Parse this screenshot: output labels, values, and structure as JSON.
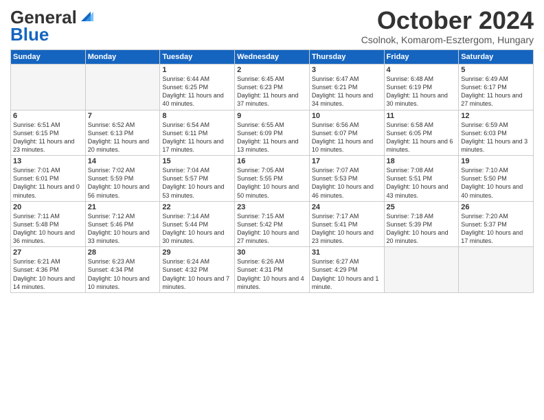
{
  "header": {
    "logo_top": "General",
    "logo_bottom": "Blue",
    "month_title": "October 2024",
    "subtitle": "Csolnok, Komarom-Esztergom, Hungary"
  },
  "days_of_week": [
    "Sunday",
    "Monday",
    "Tuesday",
    "Wednesday",
    "Thursday",
    "Friday",
    "Saturday"
  ],
  "weeks": [
    [
      {
        "day": "",
        "empty": true
      },
      {
        "day": "",
        "empty": true
      },
      {
        "day": "1",
        "sunrise": "Sunrise: 6:44 AM",
        "sunset": "Sunset: 6:25 PM",
        "daylight": "Daylight: 11 hours and 40 minutes."
      },
      {
        "day": "2",
        "sunrise": "Sunrise: 6:45 AM",
        "sunset": "Sunset: 6:23 PM",
        "daylight": "Daylight: 11 hours and 37 minutes."
      },
      {
        "day": "3",
        "sunrise": "Sunrise: 6:47 AM",
        "sunset": "Sunset: 6:21 PM",
        "daylight": "Daylight: 11 hours and 34 minutes."
      },
      {
        "day": "4",
        "sunrise": "Sunrise: 6:48 AM",
        "sunset": "Sunset: 6:19 PM",
        "daylight": "Daylight: 11 hours and 30 minutes."
      },
      {
        "day": "5",
        "sunrise": "Sunrise: 6:49 AM",
        "sunset": "Sunset: 6:17 PM",
        "daylight": "Daylight: 11 hours and 27 minutes."
      }
    ],
    [
      {
        "day": "6",
        "sunrise": "Sunrise: 6:51 AM",
        "sunset": "Sunset: 6:15 PM",
        "daylight": "Daylight: 11 hours and 23 minutes."
      },
      {
        "day": "7",
        "sunrise": "Sunrise: 6:52 AM",
        "sunset": "Sunset: 6:13 PM",
        "daylight": "Daylight: 11 hours and 20 minutes."
      },
      {
        "day": "8",
        "sunrise": "Sunrise: 6:54 AM",
        "sunset": "Sunset: 6:11 PM",
        "daylight": "Daylight: 11 hours and 17 minutes."
      },
      {
        "day": "9",
        "sunrise": "Sunrise: 6:55 AM",
        "sunset": "Sunset: 6:09 PM",
        "daylight": "Daylight: 11 hours and 13 minutes."
      },
      {
        "day": "10",
        "sunrise": "Sunrise: 6:56 AM",
        "sunset": "Sunset: 6:07 PM",
        "daylight": "Daylight: 11 hours and 10 minutes."
      },
      {
        "day": "11",
        "sunrise": "Sunrise: 6:58 AM",
        "sunset": "Sunset: 6:05 PM",
        "daylight": "Daylight: 11 hours and 6 minutes."
      },
      {
        "day": "12",
        "sunrise": "Sunrise: 6:59 AM",
        "sunset": "Sunset: 6:03 PM",
        "daylight": "Daylight: 11 hours and 3 minutes."
      }
    ],
    [
      {
        "day": "13",
        "sunrise": "Sunrise: 7:01 AM",
        "sunset": "Sunset: 6:01 PM",
        "daylight": "Daylight: 11 hours and 0 minutes."
      },
      {
        "day": "14",
        "sunrise": "Sunrise: 7:02 AM",
        "sunset": "Sunset: 5:59 PM",
        "daylight": "Daylight: 10 hours and 56 minutes."
      },
      {
        "day": "15",
        "sunrise": "Sunrise: 7:04 AM",
        "sunset": "Sunset: 5:57 PM",
        "daylight": "Daylight: 10 hours and 53 minutes."
      },
      {
        "day": "16",
        "sunrise": "Sunrise: 7:05 AM",
        "sunset": "Sunset: 5:55 PM",
        "daylight": "Daylight: 10 hours and 50 minutes."
      },
      {
        "day": "17",
        "sunrise": "Sunrise: 7:07 AM",
        "sunset": "Sunset: 5:53 PM",
        "daylight": "Daylight: 10 hours and 46 minutes."
      },
      {
        "day": "18",
        "sunrise": "Sunrise: 7:08 AM",
        "sunset": "Sunset: 5:51 PM",
        "daylight": "Daylight: 10 hours and 43 minutes."
      },
      {
        "day": "19",
        "sunrise": "Sunrise: 7:10 AM",
        "sunset": "Sunset: 5:50 PM",
        "daylight": "Daylight: 10 hours and 40 minutes."
      }
    ],
    [
      {
        "day": "20",
        "sunrise": "Sunrise: 7:11 AM",
        "sunset": "Sunset: 5:48 PM",
        "daylight": "Daylight: 10 hours and 36 minutes."
      },
      {
        "day": "21",
        "sunrise": "Sunrise: 7:12 AM",
        "sunset": "Sunset: 5:46 PM",
        "daylight": "Daylight: 10 hours and 33 minutes."
      },
      {
        "day": "22",
        "sunrise": "Sunrise: 7:14 AM",
        "sunset": "Sunset: 5:44 PM",
        "daylight": "Daylight: 10 hours and 30 minutes."
      },
      {
        "day": "23",
        "sunrise": "Sunrise: 7:15 AM",
        "sunset": "Sunset: 5:42 PM",
        "daylight": "Daylight: 10 hours and 27 minutes."
      },
      {
        "day": "24",
        "sunrise": "Sunrise: 7:17 AM",
        "sunset": "Sunset: 5:41 PM",
        "daylight": "Daylight: 10 hours and 23 minutes."
      },
      {
        "day": "25",
        "sunrise": "Sunrise: 7:18 AM",
        "sunset": "Sunset: 5:39 PM",
        "daylight": "Daylight: 10 hours and 20 minutes."
      },
      {
        "day": "26",
        "sunrise": "Sunrise: 7:20 AM",
        "sunset": "Sunset: 5:37 PM",
        "daylight": "Daylight: 10 hours and 17 minutes."
      }
    ],
    [
      {
        "day": "27",
        "sunrise": "Sunrise: 6:21 AM",
        "sunset": "Sunset: 4:36 PM",
        "daylight": "Daylight: 10 hours and 14 minutes."
      },
      {
        "day": "28",
        "sunrise": "Sunrise: 6:23 AM",
        "sunset": "Sunset: 4:34 PM",
        "daylight": "Daylight: 10 hours and 10 minutes."
      },
      {
        "day": "29",
        "sunrise": "Sunrise: 6:24 AM",
        "sunset": "Sunset: 4:32 PM",
        "daylight": "Daylight: 10 hours and 7 minutes."
      },
      {
        "day": "30",
        "sunrise": "Sunrise: 6:26 AM",
        "sunset": "Sunset: 4:31 PM",
        "daylight": "Daylight: 10 hours and 4 minutes."
      },
      {
        "day": "31",
        "sunrise": "Sunrise: 6:27 AM",
        "sunset": "Sunset: 4:29 PM",
        "daylight": "Daylight: 10 hours and 1 minute."
      },
      {
        "day": "",
        "empty": true
      },
      {
        "day": "",
        "empty": true
      }
    ]
  ]
}
